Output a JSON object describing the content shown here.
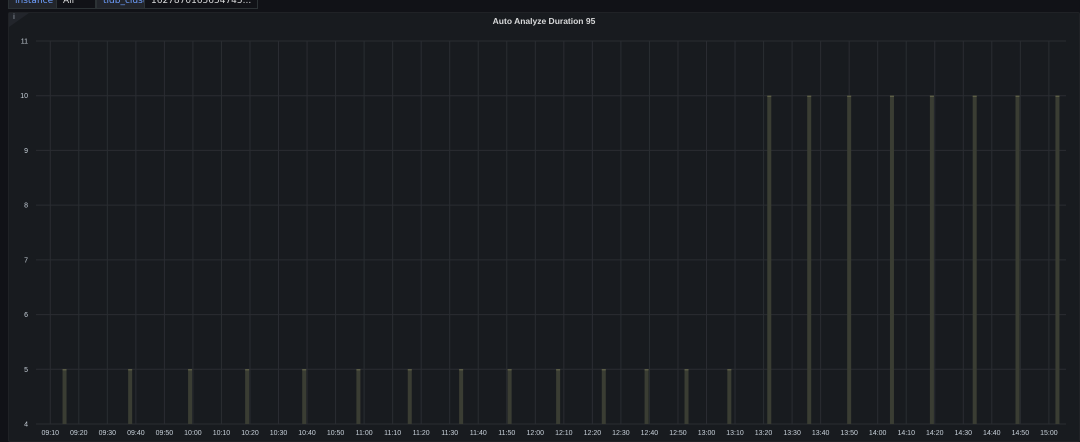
{
  "variables": {
    "items": [
      {
        "label": "instance",
        "value": "All"
      },
      {
        "label": "tidb_cluster",
        "value": "1627870165654745..."
      }
    ]
  },
  "panel": {
    "info_icon": "info-icon"
  },
  "chart_data": {
    "type": "bar",
    "title": "Auto Analyze Duration 95",
    "xlabel": "",
    "ylabel": "",
    "ylim": [
      4,
      11
    ],
    "yticks": [
      "4",
      "5",
      "6",
      "7",
      "8",
      "9",
      "10",
      "11"
    ],
    "xticks": [
      "09:10",
      "09:20",
      "09:30",
      "09:40",
      "09:50",
      "10:00",
      "10:10",
      "10:20",
      "10:30",
      "10:40",
      "10:50",
      "11:00",
      "11:10",
      "11:20",
      "11:30",
      "11:40",
      "11:50",
      "12:00",
      "12:10",
      "12:20",
      "12:30",
      "12:40",
      "12:50",
      "13:00",
      "13:10",
      "13:20",
      "13:30",
      "13:40",
      "13:50",
      "14:00",
      "14:10",
      "14:20",
      "14:30",
      "14:40",
      "14:50",
      "15:00"
    ],
    "x_range": [
      "09:05",
      "15:06"
    ],
    "grid": true,
    "bar_color": "#3a3d33",
    "bar_edge_color": "#6b6c4e",
    "series": [
      {
        "points": [
          {
            "x": "09:15",
            "y": 5
          },
          {
            "x": "09:38",
            "y": 5
          },
          {
            "x": "09:59",
            "y": 5
          },
          {
            "x": "10:19",
            "y": 5
          },
          {
            "x": "10:39",
            "y": 5
          },
          {
            "x": "10:58",
            "y": 5
          },
          {
            "x": "11:16",
            "y": 5
          },
          {
            "x": "11:34",
            "y": 5
          },
          {
            "x": "11:51",
            "y": 5
          },
          {
            "x": "12:08",
            "y": 5
          },
          {
            "x": "12:24",
            "y": 5
          },
          {
            "x": "12:39",
            "y": 5
          },
          {
            "x": "12:53",
            "y": 5
          },
          {
            "x": "13:08",
            "y": 5
          },
          {
            "x": "13:22",
            "y": 10
          },
          {
            "x": "13:36",
            "y": 10
          },
          {
            "x": "13:50",
            "y": 10
          },
          {
            "x": "14:05",
            "y": 10
          },
          {
            "x": "14:19",
            "y": 10
          },
          {
            "x": "14:34",
            "y": 10
          },
          {
            "x": "14:49",
            "y": 10
          },
          {
            "x": "15:03",
            "y": 10
          }
        ]
      }
    ]
  }
}
